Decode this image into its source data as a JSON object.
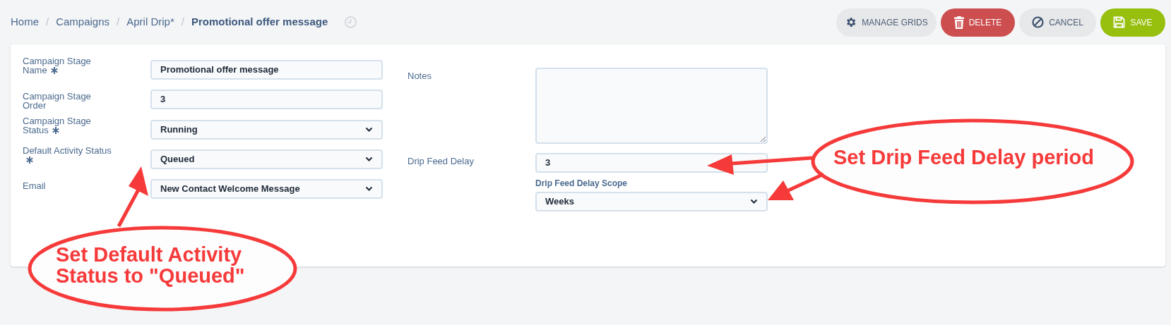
{
  "breadcrumb": [
    {
      "label": "Home",
      "current": false
    },
    {
      "label": "Campaigns",
      "current": false
    },
    {
      "label": "April Drip*",
      "current": false
    },
    {
      "label": "Promotional offer message",
      "current": true
    }
  ],
  "separator": "/",
  "actions": [
    {
      "kind": "manage",
      "label": "MANAGE GRIDS"
    },
    {
      "kind": "delete",
      "label": "DELETE"
    },
    {
      "kind": "cancel",
      "label": "CANCEL"
    },
    {
      "kind": "save",
      "label": "SAVE"
    }
  ],
  "left_fields": [
    {
      "label": "Campaign Stage Name",
      "required": true,
      "kind": "text",
      "value": "Promotional offer message"
    },
    {
      "label": "Campaign Stage Order",
      "required": false,
      "kind": "text",
      "value": "3"
    },
    {
      "label": "Campaign Stage Status",
      "required": true,
      "kind": "select",
      "value": "Running"
    },
    {
      "label": "Default Activity Status",
      "required": true,
      "kind": "select",
      "value": "Queued"
    },
    {
      "label": "Email",
      "required": false,
      "kind": "select",
      "value": "New Contact Welcome Message"
    }
  ],
  "notes": {
    "label": "Notes"
  },
  "drip_feed_delay": {
    "label": "Drip Feed Delay",
    "value": "3"
  },
  "drip_feed_delay_scope": {
    "label": "Drip Feed Delay Scope",
    "value": "Weeks"
  },
  "annotations": [
    {
      "lines": [
        "Set Default Activity",
        "Status to \"Queued\""
      ]
    },
    {
      "lines": [
        "Set Drip Feed Delay period"
      ]
    }
  ]
}
